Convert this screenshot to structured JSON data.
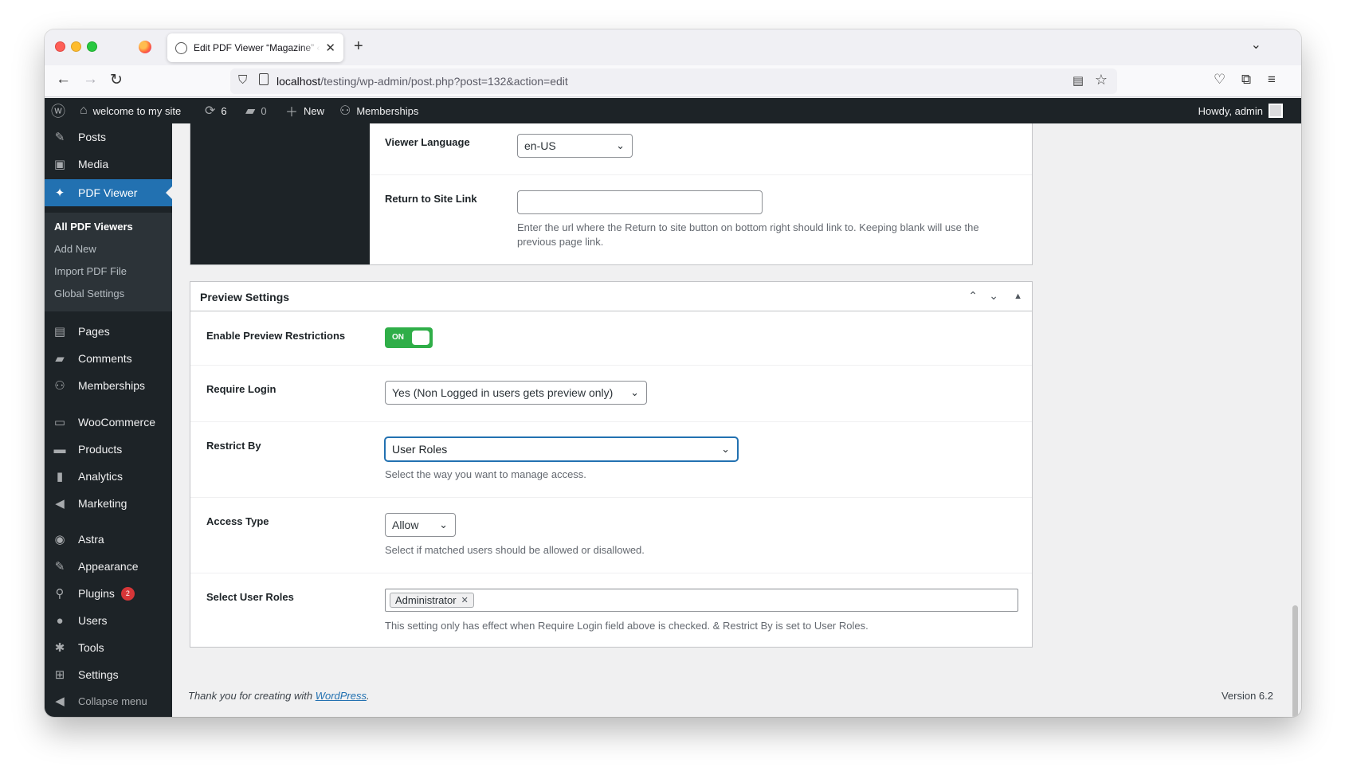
{
  "browser": {
    "tab_title": "Edit PDF Viewer “Magazine” ‹ welcome to my site — WordPress",
    "url_host": "localhost",
    "url_path": "/testing/wp-admin/post.php?post=132&action=edit"
  },
  "adminbar": {
    "site_name": "welcome to my site",
    "updates_count": "6",
    "comments_count": "0",
    "new_label": "New",
    "memberships_label": "Memberships",
    "howdy": "Howdy, admin"
  },
  "sidebar": {
    "items": [
      {
        "label": "Posts",
        "icon": "pin-icon"
      },
      {
        "label": "Media",
        "icon": "media-icon"
      },
      {
        "label": "PDF Viewer",
        "icon": "pdf-viewer-icon"
      },
      {
        "label": "Pages",
        "icon": "pages-icon"
      },
      {
        "label": "Comments",
        "icon": "comments-icon"
      },
      {
        "label": "Memberships",
        "icon": "memberships-icon"
      },
      {
        "label": "WooCommerce",
        "icon": "woocommerce-icon"
      },
      {
        "label": "Products",
        "icon": "products-icon"
      },
      {
        "label": "Analytics",
        "icon": "analytics-icon"
      },
      {
        "label": "Marketing",
        "icon": "marketing-icon"
      },
      {
        "label": "Astra",
        "icon": "astra-icon"
      },
      {
        "label": "Appearance",
        "icon": "appearance-icon"
      },
      {
        "label": "Plugins",
        "icon": "plugins-icon"
      },
      {
        "label": "Users",
        "icon": "users-icon"
      },
      {
        "label": "Tools",
        "icon": "tools-icon"
      },
      {
        "label": "Settings",
        "icon": "settings-icon"
      }
    ],
    "plugins_badge": "2",
    "submenu": [
      "All PDF Viewers",
      "Add New",
      "Import PDF File",
      "Global Settings"
    ],
    "collapse_label": "Collapse menu"
  },
  "viewer_box": {
    "viewer_language_label": "Viewer Language",
    "viewer_language_value": "en-US",
    "return_link_label": "Return to Site Link",
    "return_link_value": "",
    "return_link_desc": "Enter the url where the Return to site button on bottom right should link to. Keeping blank will use the previous page link."
  },
  "preview_box": {
    "title": "Preview Settings",
    "enable_label": "Enable Preview Restrictions",
    "enable_toggle_text": "ON",
    "require_login_label": "Require Login",
    "require_login_value": "Yes (Non Logged in users gets preview only)",
    "restrict_by_label": "Restrict By",
    "restrict_by_value": "User Roles",
    "restrict_by_desc": "Select the way you want to manage access.",
    "access_type_label": "Access Type",
    "access_type_value": "Allow",
    "access_type_desc": "Select if matched users should be allowed or disallowed.",
    "user_roles_label": "Select User Roles",
    "user_roles_tags": [
      "Administrator"
    ],
    "user_roles_desc": "This setting only has effect when Require Login field above is checked. & Restrict By is set to User Roles."
  },
  "footer": {
    "thanks_prefix": "Thank you for creating with ",
    "wordpress_link": "WordPress",
    "thanks_suffix": ".",
    "version": "Version 6.2"
  },
  "colors": {
    "admin_dark": "#1d2327",
    "accent_blue": "#2271b1",
    "toggle_green": "#2fae48",
    "badge_red": "#d63638"
  }
}
